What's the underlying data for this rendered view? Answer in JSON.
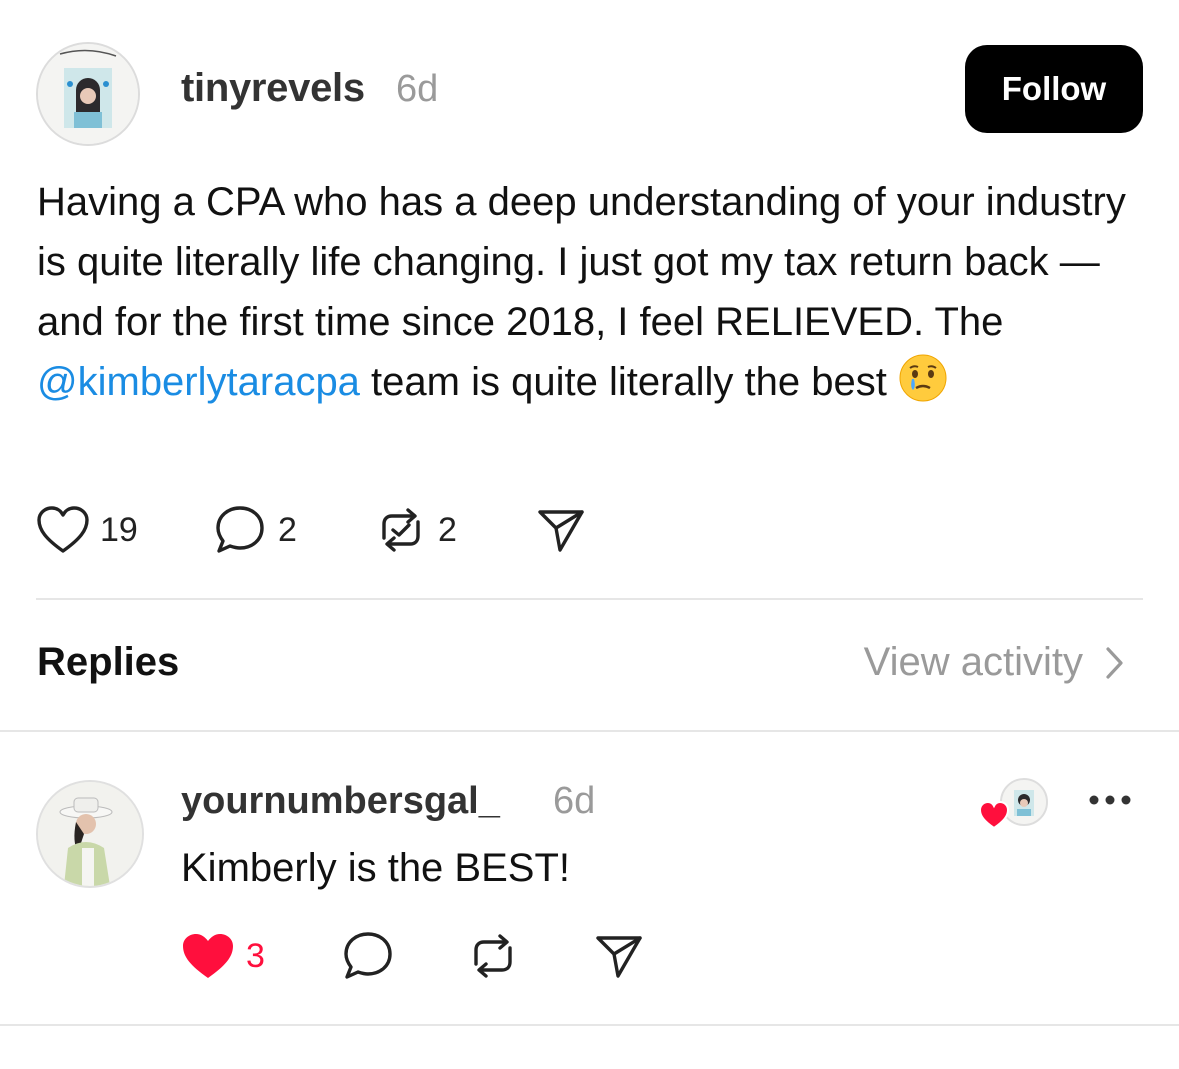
{
  "post": {
    "username": "tinyrevels",
    "time": "6d",
    "follow_label": "Follow",
    "text_before_mention": "Having a CPA who has a deep understanding of your industry is quite literally life changing. I just got my tax return back — and for the first time since 2018, I feel RELIEVED. The ",
    "mention": "@kimberlytaracpa",
    "text_after_mention": " team is quite literally the best",
    "emoji": "face-holding-back-tears",
    "likes": "19",
    "comments": "2",
    "reposts": "2"
  },
  "replies_section": {
    "title": "Replies",
    "view_activity": "View activity"
  },
  "reply": {
    "username": "yournumbersgal_",
    "time": "6d",
    "text": "Kimberly is the BEST!",
    "likes": "3",
    "liked": true
  },
  "colors": {
    "mention": "#1a8ce3",
    "like_red": "#ff0f3d",
    "muted": "#9a9a9a"
  }
}
